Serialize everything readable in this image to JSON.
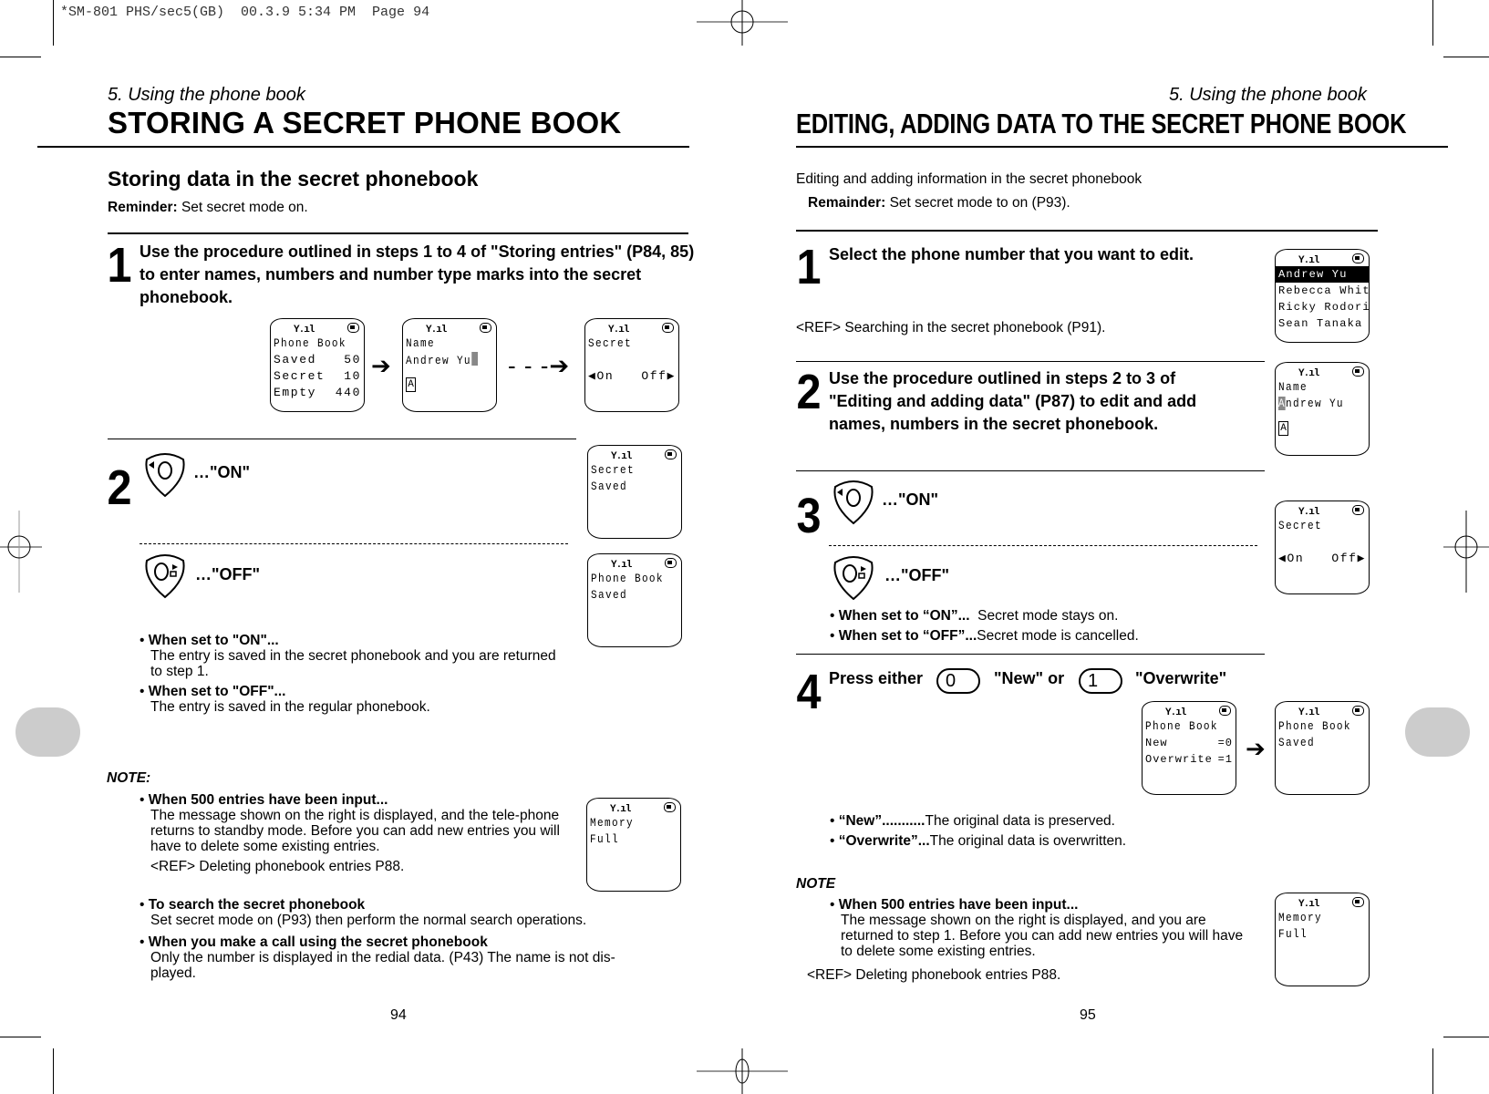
{
  "slug": "*SM-801 PHS/sec5(GB)  00.3.9 5:34 PM  Page 94",
  "left_page": {
    "section": "5. Using the phone book",
    "title": "STORING A SECRET PHONE BOOK",
    "subtitle": "Storing data in the secret phonebook",
    "reminder_label": "Reminder:",
    "reminder_text": " Set secret mode on.",
    "step1": {
      "number": "1",
      "text": "Use the procedure outlined in steps 1 to 4 of \"Storing entries\" (P84, 85) to enter names, numbers and number type marks into the secret phonebook."
    },
    "screens_step1": [
      {
        "title": "Phone Book",
        "rows": [
          [
            "Saved",
            "50"
          ],
          [
            "Secret",
            "10"
          ],
          [
            "Empty",
            "440"
          ]
        ]
      },
      {
        "line1": "Name",
        "line2": "Andrew Yu",
        "mode": "A"
      },
      {
        "line1": "Secret",
        "left_option": "On",
        "right_option": "Off"
      }
    ],
    "step2": {
      "number": "2",
      "on_label": "…\"ON\"",
      "off_label": "…\"OFF\"",
      "screen_on": {
        "line1": "Secret",
        "line2": "Saved"
      },
      "screen_off": {
        "line1": "Phone Book",
        "line2": "Saved"
      },
      "bullets": [
        {
          "label": "When set to \"ON\"...",
          "text": "The entry is saved in the secret phonebook and you are returned to step 1."
        },
        {
          "label": "When set to \"OFF\"...",
          "text": "The entry is saved in the regular phonebook."
        }
      ]
    },
    "note": {
      "heading": "NOTE:",
      "items": [
        {
          "label": "When 500 entries have been input...",
          "text": "The message shown on the right is displayed, and the tele-phone returns to standby mode. Before you can add new entries you will have to delete some existing entries.",
          "ref": "<REF> Deleting phonebook entries P88."
        },
        {
          "label": "To search the secret phonebook",
          "text": "Set secret mode on (P93) then perform the normal search operations."
        },
        {
          "label": "When you make a call using the secret phonebook",
          "text": "Only the number is displayed in the redial data. (P43) The name is not dis-played."
        }
      ],
      "screen": {
        "line1": "Memory",
        "line2": "Full"
      }
    },
    "page_number": "94"
  },
  "right_page": {
    "section": "5. Using the phone book",
    "title": "EDITING, ADDING DATA TO THE SECRET PHONE BOOK",
    "intro": "Editing and adding information in the secret phonebook",
    "reminder_label": "Remainder:",
    "reminder_text": " Set secret mode to on (P93).",
    "step1": {
      "number": "1",
      "text": "Select the phone number that you want to edit.",
      "ref": "<REF> Searching in the secret phonebook (P91).",
      "screen": {
        "entries": [
          "Andrew Yu",
          "Rebecca Whit",
          "Ricky Rodori",
          "Sean Tanaka"
        ],
        "selected": 0
      }
    },
    "step2": {
      "number": "2",
      "text": "Use the procedure outlined in steps 2 to 3 of \"Editing and adding data\" (P87) to edit and add names, numbers in the secret phonebook.",
      "screen": {
        "line1": "Name",
        "cursor_char": "A",
        "line2_rest": "ndrew Yu",
        "mode": "A"
      }
    },
    "step3": {
      "number": "3",
      "on_label": "…\"ON\"",
      "off_label": "…\"OFF\"",
      "screen": {
        "line1": "Secret",
        "left_option": "On",
        "right_option": "Off"
      },
      "bullets": [
        {
          "label": "When set to “ON”...",
          "text": "  Secret mode stays on."
        },
        {
          "label": "When set to “OFF”...",
          "text": "Secret mode is cancelled."
        }
      ]
    },
    "step4": {
      "number": "4",
      "press_either": "Press either",
      "key_new": "0",
      "new_label": "\"New\" or",
      "key_overwrite": "1",
      "overwrite_label": "\"Overwrite\"",
      "screen_choice": {
        "title": "Phone Book",
        "rows": [
          [
            "New",
            "=0"
          ],
          [
            "Overwrite",
            "=1"
          ]
        ]
      },
      "screen_saved": {
        "line1": "Phone Book",
        "line2": "Saved"
      },
      "bullets": [
        {
          "label": "“New”...........",
          "text": "The original data is preserved."
        },
        {
          "label": "“Overwrite”...",
          "text": "The original data is overwritten."
        }
      ]
    },
    "note": {
      "heading": "NOTE",
      "items": [
        {
          "label": "When 500 entries have been input...",
          "text": "The message shown on the right is displayed, and you are returned to step 1. Before you can add new entries you will have to delete some existing entries."
        }
      ],
      "ref": "<REF> Deleting phonebook entries P88.",
      "screen": {
        "line1": "Memory",
        "line2": "Full"
      }
    },
    "page_number": "95"
  },
  "arrows": {
    "solid": "➔",
    "dashed": "- - -➔"
  }
}
